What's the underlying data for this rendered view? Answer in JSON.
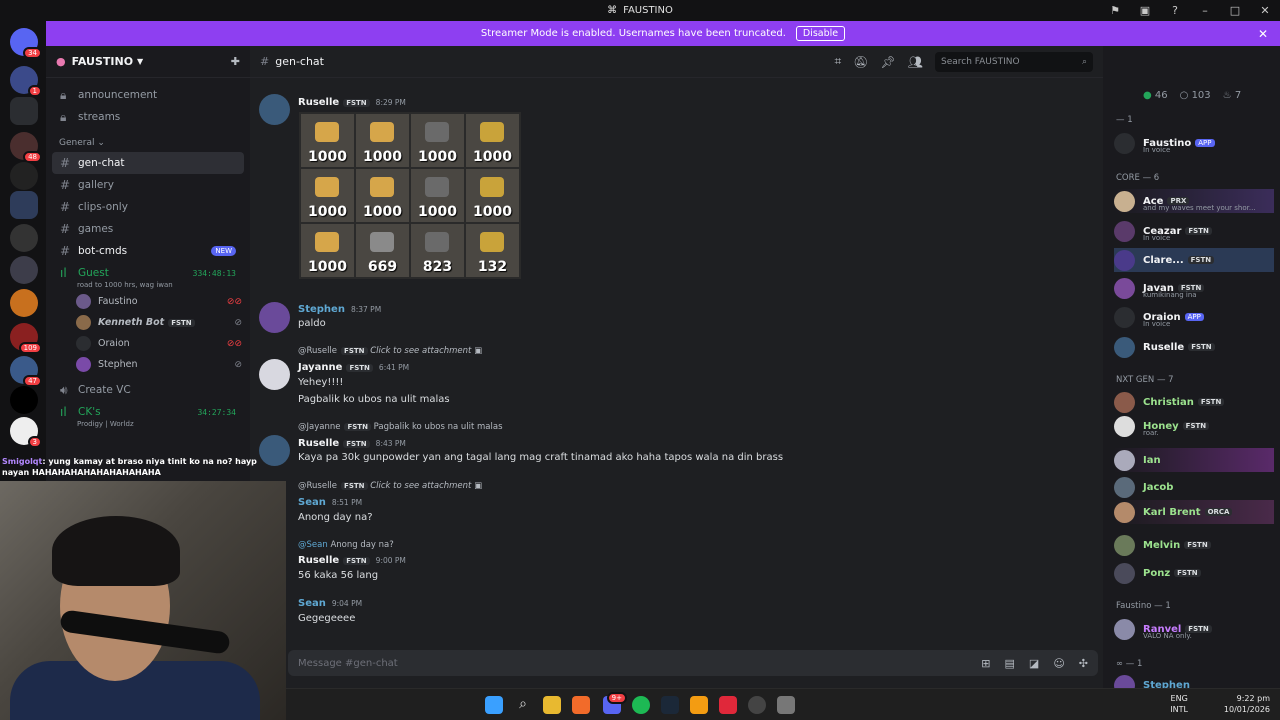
{
  "window": {
    "title": "FAUSTINO"
  },
  "banner": {
    "text": "Streamer Mode is enabled. Usernames have been truncated.",
    "disable_label": "Disable"
  },
  "servers": {
    "badges": [
      "34",
      "1",
      "48",
      "109",
      "47",
      "3"
    ]
  },
  "sidebar": {
    "server_name": "FAUSTINO",
    "channels_top": [
      "announcement",
      "streams"
    ],
    "category": "General",
    "channels": [
      "gen-chat",
      "gallery",
      "clips-only",
      "games",
      "bot-cmds"
    ],
    "new_badge": "NEW",
    "voice1": {
      "name": "Guest",
      "timer": "334:48:13",
      "status": "road to 1000 hrs, wag iwan",
      "users": [
        {
          "name": "Faustino"
        },
        {
          "name": "Kenneth Bot",
          "tag": "FSTN"
        },
        {
          "name": "Oraion"
        },
        {
          "name": "Stephen"
        }
      ]
    },
    "create_vc": "Create VC",
    "voice2": {
      "name": "CK's",
      "timer": "34:27:34",
      "status": "Prodigy | Worldz"
    }
  },
  "channel": {
    "name": "gen-chat",
    "search_placeholder": "Search FAUSTINO"
  },
  "messages": [
    {
      "author": "Ruselle",
      "tag": "FSTN",
      "time": "8:29 PM",
      "color": "#f2f3f5"
    },
    {
      "author": "Stephen",
      "time": "8:37 PM",
      "text": "paldo",
      "color": "#5fa8d3"
    },
    {
      "reply_to": "@Ruselle",
      "reply_tag": "FSTN",
      "reply_text": "Click to see attachment",
      "author": "Jayanne",
      "tag": "FSTN",
      "time": "6:41 PM",
      "text": "Yehey!!!!",
      "text2": "Pagbalik ko ubos na ulit malas",
      "color": "#f2f3f5"
    },
    {
      "reply_to": "@Jayanne",
      "reply_tag": "FSTN",
      "reply_text": "Pagbalik ko ubos na ulit malas",
      "author": "Ruselle",
      "tag": "FSTN",
      "time": "8:43 PM",
      "text": "Kaya pa 30k gunpowder yan  ang tagal lang mag craft tinamad ako haha tapos wala na din brass",
      "color": "#f2f3f5"
    },
    {
      "reply_to": "@Ruselle",
      "reply_tag": "FSTN",
      "reply_text": "Click to see attachment",
      "author": "Sean",
      "time": "8:51 PM",
      "text": "Anong day na?",
      "color": "#5fa8d3"
    },
    {
      "reply_to": "@Sean",
      "reply_text": "Anong day na?",
      "author": "Ruselle",
      "tag": "FSTN",
      "time": "9:00 PM",
      "text": "56 kaka 56 lang",
      "color": "#f2f3f5"
    },
    {
      "author": "Sean",
      "time": "9:04 PM",
      "text": "Gegegeeee",
      "color": "#5fa8d3"
    }
  ],
  "grid_values": [
    "1000",
    "1000",
    "1000",
    "1000",
    "1000",
    "1000",
    "1000",
    "1000",
    "1000",
    "669",
    "823",
    "132"
  ],
  "composer": {
    "placeholder": "Message #gen-chat"
  },
  "members": {
    "stats": [
      "46",
      "103",
      "7"
    ],
    "groups": [
      {
        "label": "— 1"
      },
      {
        "label": "CORE — 6"
      },
      {
        "label": "NXT GEN — 7"
      },
      {
        "label": "Faustino — 1"
      },
      {
        "label": "∞ — 1"
      }
    ],
    "list": [
      {
        "name": "Faustino",
        "tag": "APP",
        "status": "In voice",
        "color": "#f2f3f5"
      },
      {
        "name": "Ace",
        "tag": "PRX",
        "status": "and my waves meet your shor...",
        "color": "#f2f3f5"
      },
      {
        "name": "Ceazar",
        "tag": "FSTN",
        "status": "In voice",
        "color": "#f2f3f5"
      },
      {
        "name": "Clare...",
        "tag": "FSTN",
        "status": "",
        "color": "#f2f3f5"
      },
      {
        "name": "Javan",
        "tag": "FSTN",
        "status": "kumikinang ina",
        "color": "#f2f3f5"
      },
      {
        "name": "Oraion",
        "tag": "APP",
        "status": "In voice",
        "color": "#f2f3f5"
      },
      {
        "name": "Ruselle",
        "tag": "FSTN",
        "status": "",
        "color": "#f2f3f5"
      },
      {
        "name": "Christian",
        "tag": "FSTN",
        "status": "",
        "color": "#9ce28e"
      },
      {
        "name": "Honey",
        "tag": "FSTN",
        "status": "roar.",
        "color": "#9ce28e"
      },
      {
        "name": "Ian",
        "tag": "",
        "status": "",
        "color": "#9ce28e"
      },
      {
        "name": "Jacob",
        "tag": "",
        "status": "",
        "color": "#9ce28e"
      },
      {
        "name": "Karl Brent",
        "tag": "ORCA",
        "status": "",
        "color": "#9ce28e"
      },
      {
        "name": "Melvin",
        "tag": "FSTN",
        "status": "",
        "color": "#9ce28e"
      },
      {
        "name": "Ponz",
        "tag": "FSTN",
        "status": "",
        "color": "#9ce28e"
      },
      {
        "name": "Ranvel",
        "tag": "FSTN",
        "status": "VALO NA only.",
        "color": "#c77dff"
      },
      {
        "name": "Stephen",
        "tag": "",
        "status": "",
        "color": "#5fa8d3"
      }
    ]
  },
  "overlay_chat": {
    "user": "Smigolqt",
    "text": ": yung kamay at braso niya tinit ko na no? hayp nayan HAHAHAHAHAHAHAHAHAHA"
  },
  "taskbar": {
    "lang1": "ENG",
    "lang2": "INTL",
    "time": "9:22 pm",
    "date": "10/01/2026",
    "discord_badge": "9+"
  },
  "colors": {
    "accent": "#8e3ff1",
    "blurple": "#5865f2",
    "voice_green": "#23a55a"
  }
}
